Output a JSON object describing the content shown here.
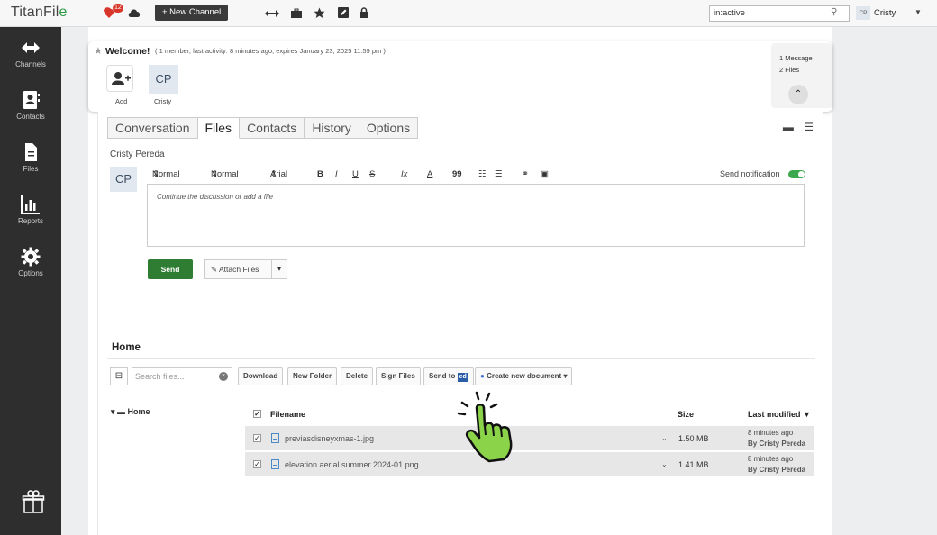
{
  "topbar": {
    "logo_main": "TitanFil",
    "logo_accent": "e",
    "notification_count": "12",
    "new_channel": "+ New Channel",
    "search_value": "in:active",
    "user_initials": "CP",
    "user_name": "Cristy"
  },
  "sidebar": {
    "items": [
      {
        "label": "Channels",
        "icon": "arrows-icon"
      },
      {
        "label": "Contacts",
        "icon": "contacts-icon"
      },
      {
        "label": "Files",
        "icon": "file-icon"
      },
      {
        "label": "Reports",
        "icon": "chart-icon"
      },
      {
        "label": "Options",
        "icon": "gear-icon"
      }
    ]
  },
  "welcome": {
    "title": "Welcome!",
    "meta": "( 1 member, last activity: 8 minutes ago, expires January 23, 2025 11:59 pm )",
    "add_label": "Add",
    "member_initials": "CP",
    "member_name": "Cristy",
    "messages": "1 Message",
    "files": "2 Files"
  },
  "tabs": [
    "Conversation",
    "Files",
    "Contacts",
    "History",
    "Options"
  ],
  "active_tab": "Files",
  "composer": {
    "author": "Cristy Pereda",
    "initials": "CP",
    "style1": "Normal",
    "style2": "Normal",
    "font": "Arial",
    "bold": "B",
    "italic": "I",
    "underline": "U",
    "strike": "S",
    "clear_format": "Ix",
    "font_color": "A",
    "quote": "99",
    "send_notification": "Send notification",
    "placeholder": "Continue the discussion or add a file",
    "send": "Send",
    "attach": "✎ Attach Files",
    "dropdown": "▾"
  },
  "files": {
    "section_title": "Home",
    "search_placeholder": "Search files...",
    "buttons": {
      "download": "Download",
      "new_folder": "New Folder",
      "delete": "Delete",
      "sign_files": "Sign Files",
      "send_to": "Send to",
      "send_to_icon": "ed",
      "create_doc": "Create new document"
    },
    "tree_root": "Home",
    "columns": {
      "filename": "Filename",
      "size": "Size",
      "modified": "Last modified ▼"
    },
    "rows": [
      {
        "name": "previasdisneyxmas-1.jpg",
        "size": "1.50 MB",
        "modified": "8 minutes ago",
        "by": "By Cristy Pereda"
      },
      {
        "name": "elevation aerial summer 2024-01.png",
        "size": "1.41 MB",
        "modified": "8 minutes ago",
        "by": "By Cristy Pereda"
      }
    ]
  },
  "colors": {
    "accent_green": "#2f7d32",
    "sidebar_bg": "#2e2e2e",
    "hand_green": "#8bd449"
  }
}
